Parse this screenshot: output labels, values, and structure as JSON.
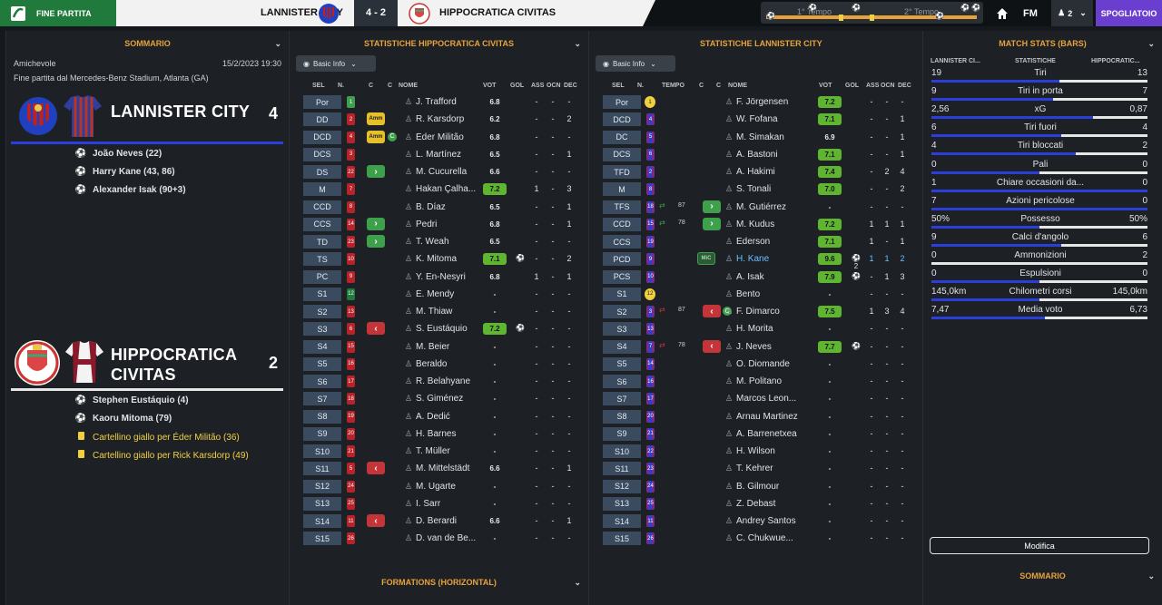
{
  "topbar": {
    "status": "FINE PARTITA",
    "home_team": "LANNISTER CITY",
    "score": "4 - 2",
    "away_team": "HIPPOCRATICA CIVITAS",
    "first_half": "1° Tempo",
    "second_half": "2° Tempo",
    "fm_label": "FM",
    "players_count": "2",
    "dressing_room": "SPOGLIATOIO"
  },
  "summary": {
    "title": "SOMMARIO",
    "match_type": "Amichevole",
    "datetime": "15/2/2023 19:30",
    "venue": "Fine partita dal Mercedes-Benz Stadium, Atlanta (GA)",
    "home": {
      "name": "LANNISTER CITY",
      "goals": "4",
      "events": [
        "João Neves (22)",
        "Harry Kane (43, 86)",
        "Alexander Isak (90+3)"
      ]
    },
    "away": {
      "name1": "HIPPOCRATICA",
      "name2": "CIVITAS",
      "goals": "2",
      "events": [
        "Stephen Eustáquio (4)",
        "Kaoru Mitoma (79)"
      ],
      "cards": [
        "Cartellino giallo per Éder Militão (36)",
        "Cartellino giallo per Rick Karsdorp (49)"
      ]
    },
    "footer_title": "SOMMARIO"
  },
  "stats_away": {
    "title": "STATISTICHE HIPPOCRATICA CIVITAS",
    "view": "Basic Info",
    "headers": {
      "sel": "SEL",
      "num": "N.",
      "c1": "C",
      "c2": "C",
      "name": "NOME",
      "vot": "VOT",
      "gol": "GOL",
      "ass": "ASS",
      "ocn": "OCN",
      "dec": "DEC"
    },
    "players": [
      {
        "pos": "Por",
        "num": "1",
        "name": "J. Trafford",
        "vot": "6.8",
        "gol": "",
        "ass": "-",
        "ocn": "-",
        "dec": "-",
        "tag": "",
        "green": false
      },
      {
        "pos": "DD",
        "num": "2",
        "name": "R. Karsdorp",
        "vot": "6.2",
        "gol": "",
        "ass": "-",
        "ocn": "-",
        "dec": "2",
        "tag": "Amm",
        "green": false
      },
      {
        "pos": "DCD",
        "num": "4",
        "name": "Éder Militão",
        "vot": "6.8",
        "gol": "",
        "ass": "-",
        "ocn": "-",
        "dec": "-",
        "tag": "Amm",
        "green": false
      },
      {
        "pos": "DCS",
        "num": "3",
        "name": "L. Martínez",
        "vot": "6.5",
        "gol": "",
        "ass": "-",
        "ocn": "-",
        "dec": "1",
        "tag": "",
        "green": false
      },
      {
        "pos": "DS",
        "num": "22",
        "name": "M. Cucurella",
        "vot": "6.6",
        "gol": "",
        "ass": "-",
        "ocn": "-",
        "dec": "-",
        "tag": "up",
        "green": false
      },
      {
        "pos": "M",
        "num": "7",
        "name": "Hakan Çalha...",
        "vot": "7.2",
        "gol": "",
        "ass": "1",
        "ocn": "-",
        "dec": "3",
        "tag": "",
        "green": true
      },
      {
        "pos": "CCD",
        "num": "8",
        "name": "B. Díaz",
        "vot": "6.5",
        "gol": "",
        "ass": "-",
        "ocn": "-",
        "dec": "1",
        "tag": "",
        "green": false
      },
      {
        "pos": "CCS",
        "num": "14",
        "name": "Pedri",
        "vot": "6.8",
        "gol": "",
        "ass": "-",
        "ocn": "-",
        "dec": "1",
        "tag": "up",
        "green": false
      },
      {
        "pos": "TD",
        "num": "23",
        "name": "T. Weah",
        "vot": "6.5",
        "gol": "",
        "ass": "-",
        "ocn": "-",
        "dec": "-",
        "tag": "up",
        "green": false
      },
      {
        "pos": "TS",
        "num": "10",
        "name": "K. Mitoma",
        "vot": "7.1",
        "gol": "⚽",
        "ass": "-",
        "ocn": "-",
        "dec": "2",
        "tag": "",
        "green": true
      },
      {
        "pos": "PC",
        "num": "9",
        "name": "Y. En-Nesyri",
        "vot": "6.8",
        "gol": "",
        "ass": "1",
        "ocn": "-",
        "dec": "1",
        "tag": "",
        "green": false
      },
      {
        "pos": "S1",
        "num": "12",
        "name": "É. Mendy",
        "vot": "-",
        "gol": "",
        "ass": "-",
        "ocn": "-",
        "dec": "-",
        "tag": "",
        "green": false
      },
      {
        "pos": "S2",
        "num": "13",
        "name": "M. Thiaw",
        "vot": "-",
        "gol": "",
        "ass": "-",
        "ocn": "-",
        "dec": "-",
        "tag": "",
        "green": false
      },
      {
        "pos": "S3",
        "num": "6",
        "name": "S. Eustáquio",
        "vot": "7.2",
        "gol": "⚽",
        "ass": "-",
        "ocn": "-",
        "dec": "-",
        "tag": "dn",
        "green": true
      },
      {
        "pos": "S4",
        "num": "15",
        "name": "M. Beier",
        "vot": "-",
        "gol": "",
        "ass": "-",
        "ocn": "-",
        "dec": "-",
        "tag": "",
        "green": false
      },
      {
        "pos": "S5",
        "num": "16",
        "name": "Beraldo",
        "vot": "-",
        "gol": "",
        "ass": "-",
        "ocn": "-",
        "dec": "-",
        "tag": "",
        "green": false
      },
      {
        "pos": "S6",
        "num": "17",
        "name": "R. Belahyane",
        "vot": "-",
        "gol": "",
        "ass": "-",
        "ocn": "-",
        "dec": "-",
        "tag": "",
        "green": false
      },
      {
        "pos": "S7",
        "num": "18",
        "name": "S. Giménez",
        "vot": "-",
        "gol": "",
        "ass": "-",
        "ocn": "-",
        "dec": "-",
        "tag": "",
        "green": false
      },
      {
        "pos": "S8",
        "num": "19",
        "name": "A. Dedić",
        "vot": "-",
        "gol": "",
        "ass": "-",
        "ocn": "-",
        "dec": "-",
        "tag": "",
        "green": false
      },
      {
        "pos": "S9",
        "num": "20",
        "name": "H. Barnes",
        "vot": "-",
        "gol": "",
        "ass": "-",
        "ocn": "-",
        "dec": "-",
        "tag": "",
        "green": false
      },
      {
        "pos": "S10",
        "num": "21",
        "name": "T. Müller",
        "vot": "-",
        "gol": "",
        "ass": "-",
        "ocn": "-",
        "dec": "-",
        "tag": "",
        "green": false
      },
      {
        "pos": "S11",
        "num": "5",
        "name": "M. Mittelstädt",
        "vot": "6.6",
        "gol": "",
        "ass": "-",
        "ocn": "-",
        "dec": "1",
        "tag": "dn",
        "green": false
      },
      {
        "pos": "S12",
        "num": "24",
        "name": "M. Ugarte",
        "vot": "-",
        "gol": "",
        "ass": "-",
        "ocn": "-",
        "dec": "-",
        "tag": "",
        "green": false
      },
      {
        "pos": "S13",
        "num": "25",
        "name": "I. Sarr",
        "vot": "-",
        "gol": "",
        "ass": "-",
        "ocn": "-",
        "dec": "-",
        "tag": "",
        "green": false
      },
      {
        "pos": "S14",
        "num": "11",
        "name": "D. Berardi",
        "vot": "6.6",
        "gol": "",
        "ass": "-",
        "ocn": "-",
        "dec": "1",
        "tag": "dn",
        "green": false
      },
      {
        "pos": "S15",
        "num": "26",
        "name": "D. van de Be...",
        "vot": "-",
        "gol": "",
        "ass": "-",
        "ocn": "-",
        "dec": "-",
        "tag": "",
        "green": false
      }
    ],
    "footer_title": "FORMATIONS (HORIZONTAL)"
  },
  "stats_home": {
    "title": "STATISTICHE LANNISTER CITY",
    "view": "Basic Info",
    "headers": {
      "sel": "SEL",
      "num": "N.",
      "tempo": "TEMPO",
      "c": "C",
      "name": "NOME",
      "vot": "VOT",
      "gol": "GOL",
      "ass": "ASS",
      "ocn": "OCN",
      "dec": "DEC"
    },
    "players": [
      {
        "pos": "Por",
        "num": "1",
        "name": "F. Jörgensen",
        "vot": "7.2",
        "gol": "",
        "ass": "-",
        "ocn": "-",
        "dec": "-",
        "tag": "",
        "tempo": "",
        "green": true
      },
      {
        "pos": "DCD",
        "num": "4",
        "name": "W. Fofana",
        "vot": "7.1",
        "gol": "",
        "ass": "-",
        "ocn": "-",
        "dec": "1",
        "tag": "",
        "tempo": "",
        "green": true
      },
      {
        "pos": "DC",
        "num": "5",
        "name": "M. Simakan",
        "vot": "6.9",
        "gol": "",
        "ass": "-",
        "ocn": "-",
        "dec": "1",
        "tag": "",
        "tempo": "",
        "green": false
      },
      {
        "pos": "DCS",
        "num": "6",
        "name": "A. Bastoni",
        "vot": "7.1",
        "gol": "",
        "ass": "-",
        "ocn": "-",
        "dec": "1",
        "tag": "",
        "tempo": "",
        "green": true
      },
      {
        "pos": "TFD",
        "num": "2",
        "name": "A. Hakimi",
        "vot": "7.4",
        "gol": "",
        "ass": "-",
        "ocn": "2",
        "dec": "4",
        "tag": "",
        "tempo": "",
        "green": true
      },
      {
        "pos": "M",
        "num": "8",
        "name": "S. Tonali",
        "vot": "7.0",
        "gol": "",
        "ass": "-",
        "ocn": "-",
        "dec": "2",
        "tag": "",
        "tempo": "",
        "green": true
      },
      {
        "pos": "TFS",
        "num": "18",
        "name": "M. Gutiérrez",
        "vot": "-",
        "gol": "",
        "ass": "-",
        "ocn": "-",
        "dec": "-",
        "tag": "up",
        "tempo": "87",
        "green": false
      },
      {
        "pos": "CCD",
        "num": "15",
        "name": "M. Kudus",
        "vot": "7.2",
        "gol": "",
        "ass": "1",
        "ocn": "1",
        "dec": "1",
        "tag": "up",
        "tempo": "78",
        "green": true
      },
      {
        "pos": "CCS",
        "num": "19",
        "name": "Ederson",
        "vot": "7.1",
        "gol": "",
        "ass": "1",
        "ocn": "-",
        "dec": "1",
        "tag": "",
        "tempo": "",
        "green": true
      },
      {
        "pos": "PCD",
        "num": "9",
        "name": "H. Kane",
        "vot": "9.6",
        "gol": "⚽2",
        "ass": "1",
        "ocn": "1",
        "dec": "2",
        "tag": "MiC",
        "tempo": "",
        "green": true
      },
      {
        "pos": "PCS",
        "num": "10",
        "name": "A. Isak",
        "vot": "7.9",
        "gol": "⚽",
        "ass": "-",
        "ocn": "1",
        "dec": "3",
        "tag": "",
        "tempo": "",
        "green": true
      },
      {
        "pos": "S1",
        "num": "12",
        "name": "Bento",
        "vot": "-",
        "gol": "",
        "ass": "-",
        "ocn": "-",
        "dec": "-",
        "tag": "",
        "tempo": "",
        "green": false
      },
      {
        "pos": "S2",
        "num": "3",
        "name": "F. Dimarco",
        "vot": "7.5",
        "gol": "",
        "ass": "1",
        "ocn": "3",
        "dec": "4",
        "tag": "dn",
        "tempo": "87",
        "green": true
      },
      {
        "pos": "S3",
        "num": "13",
        "name": "H. Morita",
        "vot": "-",
        "gol": "",
        "ass": "-",
        "ocn": "-",
        "dec": "-",
        "tag": "",
        "tempo": "",
        "green": false
      },
      {
        "pos": "S4",
        "num": "7",
        "name": "J. Neves",
        "vot": "7.7",
        "gol": "⚽",
        "ass": "-",
        "ocn": "-",
        "dec": "-",
        "tag": "dn",
        "tempo": "78",
        "green": true
      },
      {
        "pos": "S5",
        "num": "14",
        "name": "O. Diomande",
        "vot": "-",
        "gol": "",
        "ass": "-",
        "ocn": "-",
        "dec": "-",
        "tag": "",
        "tempo": "",
        "green": false
      },
      {
        "pos": "S6",
        "num": "16",
        "name": "M. Politano",
        "vot": "-",
        "gol": "",
        "ass": "-",
        "ocn": "-",
        "dec": "-",
        "tag": "",
        "tempo": "",
        "green": false
      },
      {
        "pos": "S7",
        "num": "17",
        "name": "Marcos Leon...",
        "vot": "-",
        "gol": "",
        "ass": "-",
        "ocn": "-",
        "dec": "-",
        "tag": "",
        "tempo": "",
        "green": false
      },
      {
        "pos": "S8",
        "num": "20",
        "name": "Arnau Martinez",
        "vot": "-",
        "gol": "",
        "ass": "-",
        "ocn": "-",
        "dec": "-",
        "tag": "",
        "tempo": "",
        "green": false
      },
      {
        "pos": "S9",
        "num": "21",
        "name": "A. Barrenetxea",
        "vot": "-",
        "gol": "",
        "ass": "-",
        "ocn": "-",
        "dec": "-",
        "tag": "",
        "tempo": "",
        "green": false
      },
      {
        "pos": "S10",
        "num": "22",
        "name": "H. Wilson",
        "vot": "-",
        "gol": "",
        "ass": "-",
        "ocn": "-",
        "dec": "-",
        "tag": "",
        "tempo": "",
        "green": false
      },
      {
        "pos": "S11",
        "num": "23",
        "name": "T. Kehrer",
        "vot": "-",
        "gol": "",
        "ass": "-",
        "ocn": "-",
        "dec": "-",
        "tag": "",
        "tempo": "",
        "green": false
      },
      {
        "pos": "S12",
        "num": "24",
        "name": "B. Gilmour",
        "vot": "-",
        "gol": "",
        "ass": "-",
        "ocn": "-",
        "dec": "-",
        "tag": "",
        "tempo": "",
        "green": false
      },
      {
        "pos": "S13",
        "num": "25",
        "name": "Z. Debast",
        "vot": "-",
        "gol": "",
        "ass": "-",
        "ocn": "-",
        "dec": "-",
        "tag": "",
        "tempo": "",
        "green": false
      },
      {
        "pos": "S14",
        "num": "11",
        "name": "Andrey Santos",
        "vot": "-",
        "gol": "",
        "ass": "-",
        "ocn": "-",
        "dec": "-",
        "tag": "",
        "tempo": "",
        "green": false
      },
      {
        "pos": "S15",
        "num": "26",
        "name": "C. Chukwue...",
        "vot": "-",
        "gol": "",
        "ass": "-",
        "ocn": "-",
        "dec": "-",
        "tag": "",
        "tempo": "",
        "green": false
      }
    ]
  },
  "match_stats": {
    "title": "MATCH STATS (BARS)",
    "col_home": "LANNISTER CI...",
    "col_mid": "STATISTICHE",
    "col_away": "HIPPOCRATIC...",
    "modify": "Modifica",
    "rows": [
      {
        "label": "Tiri",
        "home": "19",
        "away": "13",
        "frac": 0.594
      },
      {
        "label": "Tiri in porta",
        "home": "9",
        "away": "7",
        "frac": 0.5625
      },
      {
        "label": "xG",
        "home": "2,56",
        "away": "0,87",
        "frac": 0.746
      },
      {
        "label": "Tiri fuori",
        "home": "6",
        "away": "4",
        "frac": 0.6
      },
      {
        "label": "Tiri bloccati",
        "home": "4",
        "away": "2",
        "frac": 0.667
      },
      {
        "label": "Pali",
        "home": "0",
        "away": "0",
        "frac": 0.5
      },
      {
        "label": "Chiare occasioni da...",
        "home": "1",
        "away": "0",
        "frac": 1.0
      },
      {
        "label": "Azioni pericolose",
        "home": "7",
        "away": "0",
        "frac": 1.0
      },
      {
        "label": "Possesso",
        "home": "50%",
        "away": "50%",
        "frac": 0.5
      },
      {
        "label": "Calci d'angolo",
        "home": "9",
        "away": "6",
        "frac": 0.6
      },
      {
        "label": "Ammonizioni",
        "home": "0",
        "away": "2",
        "frac": 0.0
      },
      {
        "label": "Espulsioni",
        "home": "0",
        "away": "0",
        "frac": 0.5
      },
      {
        "label": "Chilometri corsi",
        "home": "145,0km",
        "away": "145,0km",
        "frac": 0.5
      },
      {
        "label": "Media voto",
        "home": "7,47",
        "away": "6,73",
        "frac": 0.526
      }
    ]
  },
  "colors": {
    "accent": "#e8a23a",
    "home_blue": "#2a3fd8",
    "green": "#5fb52f",
    "red": "#c4353a",
    "purple": "#6a3fd0"
  }
}
